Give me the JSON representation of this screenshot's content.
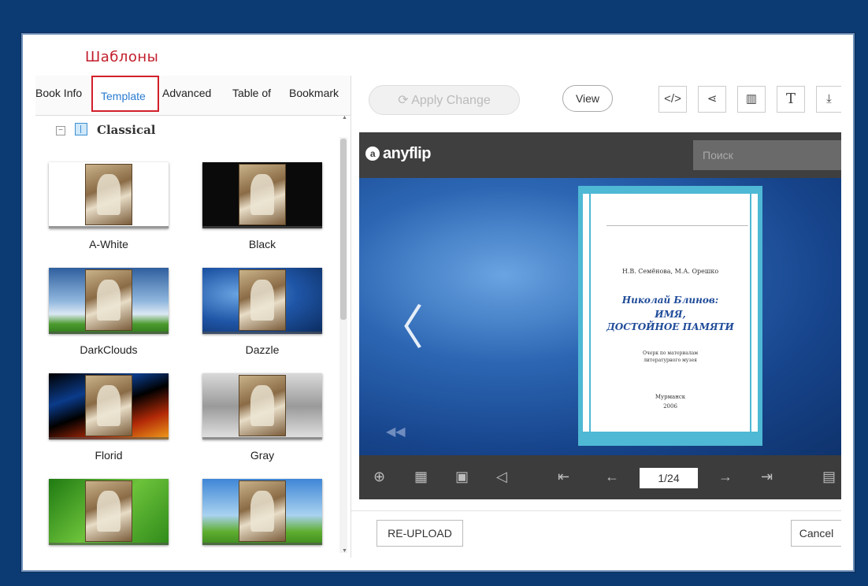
{
  "annotation": "Шаблоны",
  "tabs": [
    "Book Info",
    "Template",
    "Advanced",
    "Table of",
    "Bookmark"
  ],
  "tree": {
    "group_label": "Classical",
    "collapse_symbol": "⊟"
  },
  "templates": [
    {
      "label": "A-White"
    },
    {
      "label": "Black"
    },
    {
      "label": "DarkClouds"
    },
    {
      "label": "Dazzle"
    },
    {
      "label": "Florid"
    },
    {
      "label": "Gray"
    },
    {
      "label": ""
    },
    {
      "label": ""
    }
  ],
  "toolbar": {
    "apply_label": "Apply Change",
    "view_label": "View",
    "icons": [
      "code-icon",
      "share-icon",
      "layout-icon",
      "text-icon",
      "download-icon"
    ]
  },
  "viewer": {
    "logo_text": "anyflip",
    "search_placeholder": "Поиск",
    "page_indicator": "1/24",
    "book": {
      "authors": "Н.В. Семёнова, М.А. Орешко",
      "title_line1": "Николай Блинов:",
      "title_line2": "ИМЯ,",
      "title_line3": "ДОСТОЙНОЕ ПАМЯТИ",
      "subtitle": "Очерк по материалам литературного музея",
      "city": "Мурманск",
      "year": "2006"
    }
  },
  "footer": {
    "reupload_label": "RE-UPLOAD",
    "cancel_label": "Cancel"
  },
  "colors": {
    "background": "#0c3a73",
    "annotation_red": "#c21d2b",
    "active_tab_blue": "#2a7bd1",
    "page_accent": "#4fb8d4"
  }
}
